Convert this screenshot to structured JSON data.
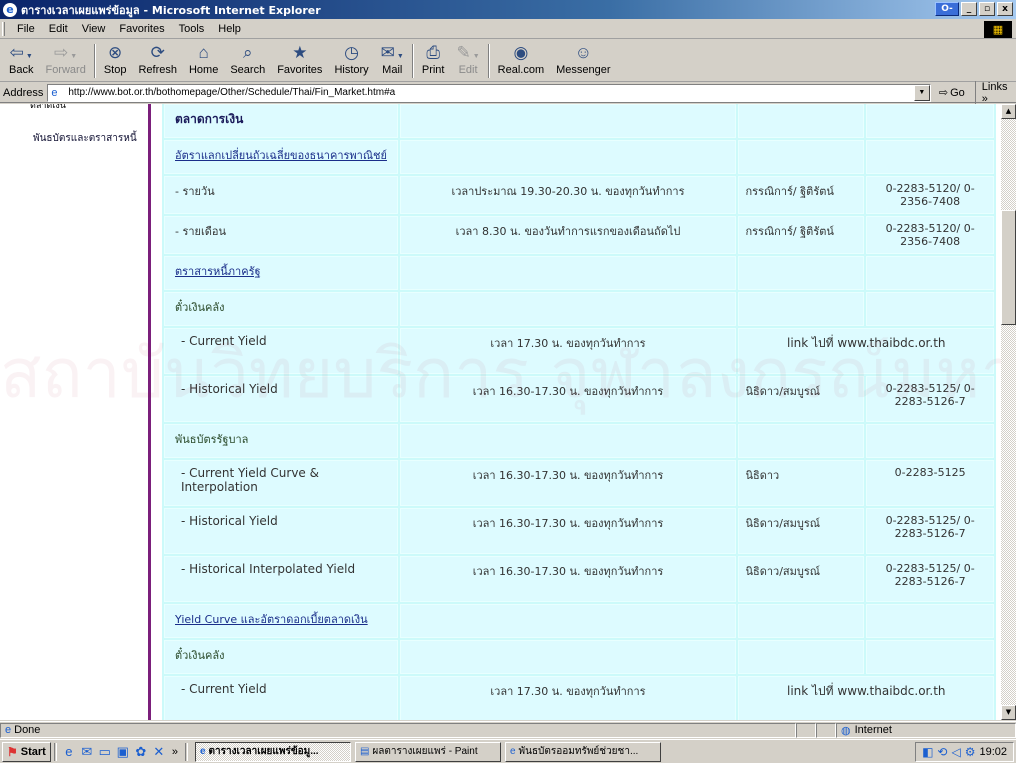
{
  "window": {
    "title": "ตารางเวลาเผยแพร่ข้อมูล - Microsoft Internet Explorer",
    "min_label": "_",
    "max_label": "▫",
    "close_label": "x",
    "help_label": "O-"
  },
  "menu": [
    "File",
    "Edit",
    "View",
    "Favorites",
    "Tools",
    "Help"
  ],
  "toolbar": [
    {
      "label": "Back",
      "icon": "back-arrow-icon",
      "glyph": "⇦",
      "disabled": false,
      "drop": true
    },
    {
      "label": "Forward",
      "icon": "forward-arrow-icon",
      "glyph": "⇨",
      "disabled": true,
      "drop": true
    },
    {
      "label": "Stop",
      "icon": "stop-icon",
      "glyph": "⊗",
      "disabled": false
    },
    {
      "label": "Refresh",
      "icon": "refresh-icon",
      "glyph": "⟳",
      "disabled": false
    },
    {
      "label": "Home",
      "icon": "home-icon",
      "glyph": "⌂",
      "disabled": false
    },
    {
      "label": "Search",
      "icon": "search-icon",
      "glyph": "⌕",
      "disabled": false
    },
    {
      "label": "Favorites",
      "icon": "favorites-icon",
      "glyph": "★",
      "disabled": false
    },
    {
      "label": "History",
      "icon": "history-icon",
      "glyph": "◷",
      "disabled": false
    },
    {
      "label": "Mail",
      "icon": "mail-icon",
      "glyph": "✉",
      "disabled": false,
      "drop": true
    },
    {
      "label": "Print",
      "icon": "print-icon",
      "glyph": "⎙",
      "disabled": false
    },
    {
      "label": "Edit",
      "icon": "edit-icon",
      "glyph": "✎",
      "disabled": true,
      "drop": true
    },
    {
      "label": "Real.com",
      "icon": "realcom-icon",
      "glyph": "◉",
      "disabled": false
    },
    {
      "label": "Messenger",
      "icon": "messenger-icon",
      "glyph": "☺",
      "disabled": false
    }
  ],
  "address": {
    "label": "Address",
    "url": "http://www.bot.or.th/bothomepage/Other/Schedule/Thai/Fin_Market.htm#a",
    "go_label": "Go",
    "links_label": "Links"
  },
  "sidebar": {
    "cut_item": "ตลาดเงิน",
    "item": "พันธบัตรและตราสารหนี้"
  },
  "watermark": "สถาบันวิทยบริการ จุฬาลงกรณ์มหาวิทยาลัย",
  "table": [
    {
      "type": "head",
      "c1": "ตลาดการเงิน"
    },
    {
      "type": "link",
      "c1": "อัตราแลกเปลี่ยนถัวเฉลี่ยของธนาคารพาณิชย์"
    },
    {
      "type": "row",
      "c1": "- รายวัน",
      "c2": "เวลาประมาณ 19.30-20.30 น. ของทุกวันทำการ",
      "c3": "กรรณิการ์/ ฐิติรัตน์",
      "c4": "0-2283-5120/ 0-2356-7408"
    },
    {
      "type": "row",
      "c1": "- รายเดือน",
      "c2": "เวลา 8.30 น. ของวันทำการแรกของเดือนถัดไป",
      "c3": "กรรณิการ์/ ฐิติรัตน์",
      "c4": "0-2283-5120/ 0-2356-7408"
    },
    {
      "type": "link",
      "c1": "ตราสารหนี้ภาครัฐ"
    },
    {
      "type": "sub",
      "c1": "ตั๋วเงินคลัง"
    },
    {
      "type": "row1",
      "c1": "- Current Yield",
      "c2": "เวลา 17.30 น. ของทุกวันทำการ",
      "c34": "link ไปที่ www.thaibdc.or.th"
    },
    {
      "type": "row1",
      "c1": "- Historical Yield",
      "c2": "เวลา 16.30-17.30 น. ของทุกวันทำการ",
      "c3": "นิธิดาว/สมบูรณ์",
      "c4": "0-2283-5125/ 0-2283-5126-7"
    },
    {
      "type": "sub",
      "c1": "พันธบัตรรัฐบาล"
    },
    {
      "type": "row1",
      "c1": "- Current Yield Curve & Interpolation",
      "c2": "เวลา 16.30-17.30 น. ของทุกวันทำการ",
      "c3": "นิธิดาว",
      "c4": "0-2283-5125"
    },
    {
      "type": "row1",
      "c1": "- Historical Yield",
      "c2": "เวลา 16.30-17.30 น. ของทุกวันทำการ",
      "c3": "นิธิดาว/สมบูรณ์",
      "c4": "0-2283-5125/ 0-2283-5126-7"
    },
    {
      "type": "row1",
      "c1": "- Historical Interpolated Yield",
      "c2": "เวลา 16.30-17.30 น. ของทุกวันทำการ",
      "c3": "นิธิดาว/สมบูรณ์",
      "c4": "0-2283-5125/ 0-2283-5126-7"
    },
    {
      "type": "link",
      "c1": "Yield Curve และอัตราดอกเบี้ยตลาดเงิน"
    },
    {
      "type": "sub",
      "c1": "ตั๋วเงินคลัง"
    },
    {
      "type": "row1",
      "c1": "- Current Yield",
      "c2": "เวลา 17.30 น. ของทุกวันทำการ",
      "c34": "link ไปที่ www.thaibdc.or.th"
    }
  ],
  "status": {
    "text": "Done",
    "zone": "Internet"
  },
  "taskbar": {
    "start": "Start",
    "chevron": "»",
    "tasks": [
      {
        "label": "ตารางเวลาเผยแพร่ข้อมู...",
        "active": true
      },
      {
        "label": "ผลตารางเผยแพร่ - Paint",
        "active": false
      },
      {
        "label": "พันธบัตรออมทรัพย์ช่วยชา...",
        "active": false
      }
    ],
    "clock": "19:02"
  }
}
